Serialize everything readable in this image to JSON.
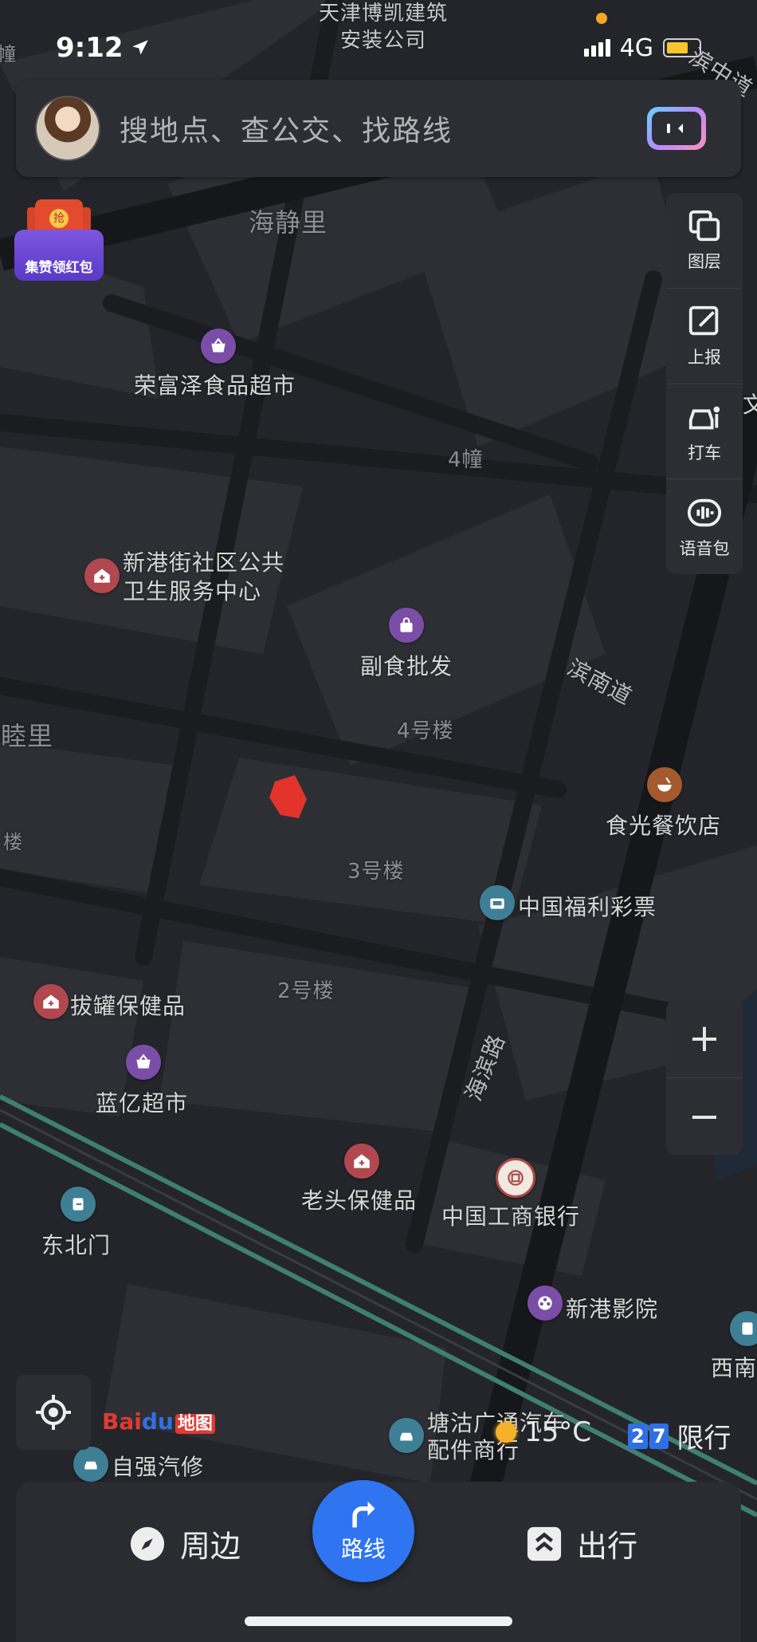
{
  "status_bar": {
    "time": "9:12",
    "network": "4G"
  },
  "search": {
    "placeholder": "搜地点、查公交、找路线"
  },
  "promo": {
    "label": "集赞领红包"
  },
  "tools": [
    {
      "label": "图层",
      "icon": "layers-icon"
    },
    {
      "label": "上报",
      "icon": "report-icon"
    },
    {
      "label": "打车",
      "icon": "taxi-icon"
    },
    {
      "label": "语音包",
      "icon": "voice-pack-icon"
    }
  ],
  "zoom": {
    "in": "+",
    "out": "−"
  },
  "map_labels": {
    "top_company": "天津博凯建筑\n安装公司",
    "haijingli": "海静里",
    "binzhongdao": "滨中道",
    "rongfuze": "荣富泽食品超市",
    "building4z": "4幢",
    "community_health": "新港街社区公共\n卫生服务中心",
    "fushi": "副食批发",
    "binnandao": "滨南道",
    "hemuli": "和睦里",
    "building4": "4号楼",
    "shiguang": "食光餐饮店",
    "building3": "3号楼",
    "lottery": "中国福利彩票",
    "building2": "2号楼",
    "baguan": "拔罐保健品",
    "haibinlu": "海滨路",
    "lanyi": "蓝亿超市",
    "laotou": "老头保健品",
    "icbc": "中国工商银行",
    "dongbeimen": "东北门",
    "xingang_cinema": "新港影院",
    "xinan": "西南",
    "tanggu_auto": "塘沽广通汽车\n配件商行",
    "ziqiang": "自强汽修",
    "edge_wen": "文",
    "edge_lou": "楼",
    "edge_chuang": "幢"
  },
  "logo": {
    "text": "Bai",
    "text2": "du",
    "map": "地图"
  },
  "weather": {
    "temp": "15°C"
  },
  "traffic_limit": {
    "digits": [
      "2",
      "7"
    ],
    "label": "限行"
  },
  "bottom": {
    "nearby": "周边",
    "route": "路线",
    "travel": "出行"
  }
}
